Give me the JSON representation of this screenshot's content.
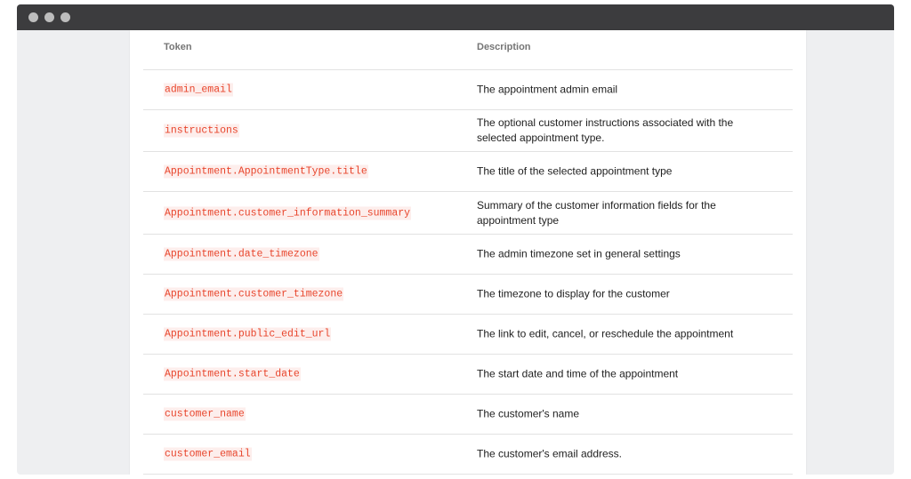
{
  "window": {
    "controls": [
      "close-dot",
      "minimize-dot",
      "maximize-dot"
    ]
  },
  "table": {
    "headers": {
      "token": "Token",
      "description": "Description"
    },
    "rows": [
      {
        "token": "admin_email",
        "description": "The appointment admin email"
      },
      {
        "token": "instructions",
        "description": "The optional customer instructions associated with the selected appointment type."
      },
      {
        "token": "Appointment.AppointmentType.title",
        "description": "The title of the selected appointment type"
      },
      {
        "token": "Appointment.customer_information_summary",
        "description": "Summary of the customer information fields for the appointment type"
      },
      {
        "token": "Appointment.date_timezone",
        "description": "The admin timezone set in general settings"
      },
      {
        "token": "Appointment.customer_timezone",
        "description": "The timezone to display for the customer"
      },
      {
        "token": "Appointment.public_edit_url",
        "description": "The link to edit, cancel, or reschedule the appointment"
      },
      {
        "token": "Appointment.start_date",
        "description": "The start date and time of the appointment"
      },
      {
        "token": "customer_name",
        "description": "The customer's name"
      },
      {
        "token": "customer_email",
        "description": "The customer's email address."
      }
    ]
  },
  "colors": {
    "token_text": "#e8452c",
    "token_bg": "#fdeeec",
    "titlebar": "#3c3c3e",
    "window_bg": "#eeeff1"
  }
}
